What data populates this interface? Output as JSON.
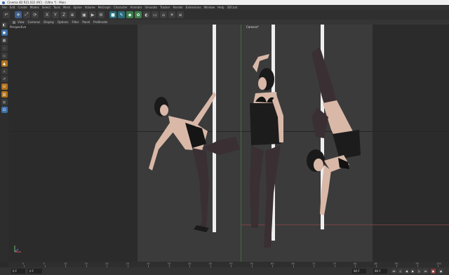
{
  "window": {
    "title": "Cinema 4D R21.022 (RC) - [Ultra *] - Main"
  },
  "menu": [
    "File",
    "Edit",
    "Create",
    "Modes",
    "Select",
    "Tools",
    "Mesh",
    "Spline",
    "Volume",
    "MoGraph",
    "Character",
    "Animate",
    "Simulate",
    "Tracker",
    "Render",
    "Extensions",
    "Window",
    "Help",
    "3DCoat"
  ],
  "toolbar": {
    "icons": [
      "undo-icon",
      "move-icon",
      "scale-icon",
      "rotate-icon",
      "x-axis-icon",
      "y-axis-icon",
      "z-axis-icon",
      "coordinate-icon",
      "render-view-icon",
      "render-icon",
      "render-settings-icon",
      "cube-icon",
      "pen-icon",
      "subdivision-icon",
      "array-icon",
      "deformer-icon",
      "floor-icon",
      "camera-icon",
      "light-icon",
      "layer-icon"
    ]
  },
  "left_toolbar": {
    "icons": [
      "make-editable-icon",
      "model-mode-icon",
      "texture-mode-icon",
      "points-mode-icon",
      "edges-mode-icon",
      "polygons-mode-icon",
      "axis-mode-icon",
      "tweak-icon",
      "snap-icon",
      "workplane-icon",
      "solo-icon",
      "lock-icon"
    ]
  },
  "viewport_menu": [
    "View",
    "Cameras",
    "Display",
    "Options",
    "Filter",
    "Panel",
    "ProRender"
  ],
  "viewport": {
    "name": "Perspective",
    "camera": "Camera*"
  },
  "timeline": {
    "ticks": [
      "0",
      "5",
      "10",
      "15",
      "20",
      "25",
      "30",
      "35",
      "40",
      "45",
      "50",
      "55",
      "60",
      "65",
      "70",
      "75",
      "80",
      "85",
      "90",
      "95",
      "100"
    ]
  },
  "transport": {
    "start_frame": "0 F",
    "current_frame": "0 F",
    "end_frame": "90 F",
    "max_frame": "90 F"
  }
}
